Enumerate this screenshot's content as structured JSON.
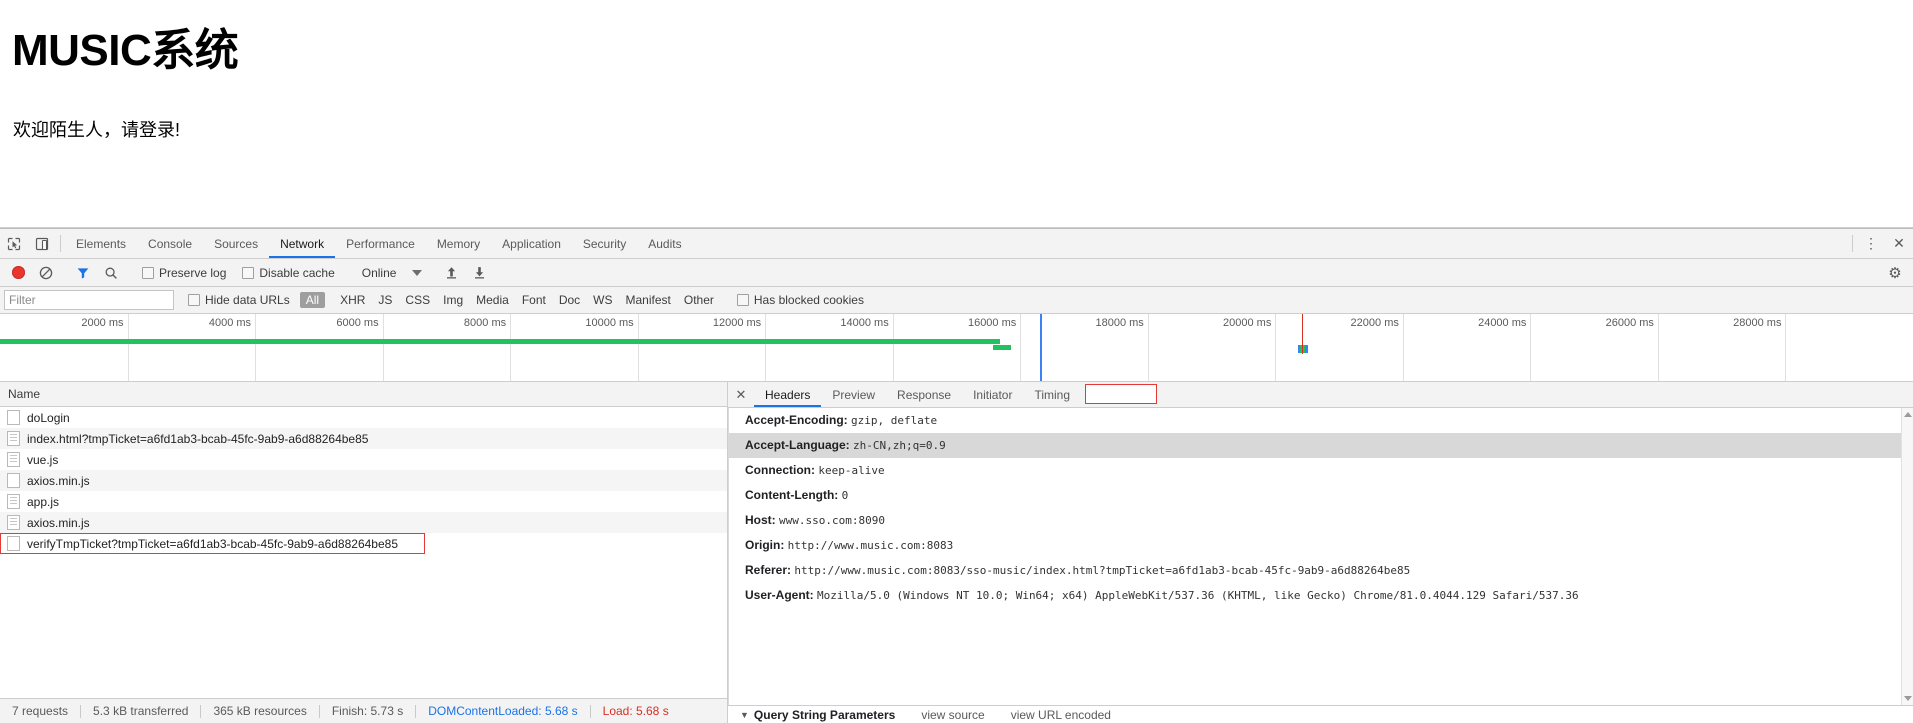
{
  "page": {
    "title": "MUSIC系统",
    "welcome": "欢迎陌生人，请登录!"
  },
  "devtools": {
    "tabs": [
      {
        "label": "Elements",
        "active": false
      },
      {
        "label": "Console",
        "active": false
      },
      {
        "label": "Sources",
        "active": false
      },
      {
        "label": "Network",
        "active": true
      },
      {
        "label": "Performance",
        "active": false
      },
      {
        "label": "Memory",
        "active": false
      },
      {
        "label": "Application",
        "active": false
      },
      {
        "label": "Security",
        "active": false
      },
      {
        "label": "Audits",
        "active": false
      }
    ],
    "more_icon": "⋮",
    "close_icon": "✕",
    "gear_icon": "⚙",
    "inspect_icon": "inspect-element-icon",
    "device_icon": "toggle-device-toolbar-icon"
  },
  "toolbar": {
    "record_title": "record-button",
    "clear_title": "clear-button",
    "filter_title": "filter-button",
    "search_title": "search-button",
    "preserve_log": "Preserve log",
    "disable_cache": "Disable cache",
    "throttling": "Online",
    "import_title": "import-har-button",
    "export_title": "export-har-button"
  },
  "filterbar": {
    "filter_placeholder": "Filter",
    "filter_value": "",
    "hide_data_urls": "Hide data URLs",
    "types": [
      {
        "label": "All",
        "active": true
      },
      {
        "label": "XHR",
        "active": false
      },
      {
        "label": "JS",
        "active": false
      },
      {
        "label": "CSS",
        "active": false
      },
      {
        "label": "Img",
        "active": false
      },
      {
        "label": "Media",
        "active": false
      },
      {
        "label": "Font",
        "active": false
      },
      {
        "label": "Doc",
        "active": false
      },
      {
        "label": "WS",
        "active": false
      },
      {
        "label": "Manifest",
        "active": false
      },
      {
        "label": "Other",
        "active": false
      }
    ],
    "has_blocked_cookies": "Has blocked cookies"
  },
  "overview": {
    "ticks": [
      "2000 ms",
      "4000 ms",
      "6000 ms",
      "8000 ms",
      "10000 ms",
      "12000 ms",
      "14000 ms",
      "16000 ms",
      "18000 ms",
      "20000 ms",
      "22000 ms",
      "24000 ms",
      "26000 ms",
      "28000 ms"
    ],
    "max_ms": 30000,
    "band_color": "#22c35e",
    "dcl_color": "#3b82f6",
    "load_color": "#d93025"
  },
  "requests": {
    "column_header": "Name",
    "rows": [
      {
        "name": "doLogin",
        "icon": "blank-doc-icon",
        "highlight": false
      },
      {
        "name": "index.html?tmpTicket=a6fd1ab3-bcab-45fc-9ab9-a6d88264be85",
        "icon": "script-doc-icon",
        "highlight": false
      },
      {
        "name": "vue.js",
        "icon": "script-doc-icon",
        "highlight": false
      },
      {
        "name": "axios.min.js",
        "icon": "blank-doc-icon",
        "highlight": false
      },
      {
        "name": "app.js",
        "icon": "script-doc-icon",
        "highlight": false
      },
      {
        "name": "axios.min.js",
        "icon": "script-doc-icon",
        "highlight": false
      },
      {
        "name": "verifyTmpTicket?tmpTicket=a6fd1ab3-bcab-45fc-9ab9-a6d88264be85",
        "icon": "blank-doc-icon",
        "highlight": true
      }
    ]
  },
  "status": {
    "requests": "7 requests",
    "transferred": "5.3 kB transferred",
    "resources": "365 kB resources",
    "finish": "Finish: 5.73 s",
    "dom_content_loaded": "DOMContentLoaded: 5.68 s",
    "load": "Load: 5.68 s",
    "dcl_color": "#1a73e8",
    "load_color": "#d93025"
  },
  "detail": {
    "close_icon": "✕",
    "tabs": [
      {
        "label": "Headers",
        "active": true
      },
      {
        "label": "Preview",
        "active": false
      },
      {
        "label": "Response",
        "active": false
      },
      {
        "label": "Initiator",
        "active": false
      },
      {
        "label": "Timing",
        "active": false
      }
    ],
    "headers": [
      {
        "name": "Accept-Encoding:",
        "value": "gzip, deflate",
        "alt": false
      },
      {
        "name": "Accept-Language:",
        "value": "zh-CN,zh;q=0.9",
        "alt": true
      },
      {
        "name": "Connection:",
        "value": "keep-alive",
        "alt": false
      },
      {
        "name": "Content-Length:",
        "value": "0",
        "alt": false
      },
      {
        "name": "Host:",
        "value": "www.sso.com:8090",
        "alt": false
      },
      {
        "name": "Origin:",
        "value": "http://www.music.com:8083",
        "alt": false
      },
      {
        "name": "Referer:",
        "value": "http://www.music.com:8083/sso-music/index.html?tmpTicket=a6fd1ab3-bcab-45fc-9ab9-a6d88264be85",
        "alt": false
      },
      {
        "name": "User-Agent:",
        "value": "Mozilla/5.0 (Windows NT 10.0; Win64; x64) AppleWebKit/537.36 (KHTML, like Gecko) Chrome/81.0.4044.129 Safari/537.36",
        "alt": false
      }
    ],
    "query_section": {
      "caret": "▼",
      "title": "Query String Parameters",
      "view_source": "view source",
      "view_url_encoded": "view URL encoded"
    }
  }
}
